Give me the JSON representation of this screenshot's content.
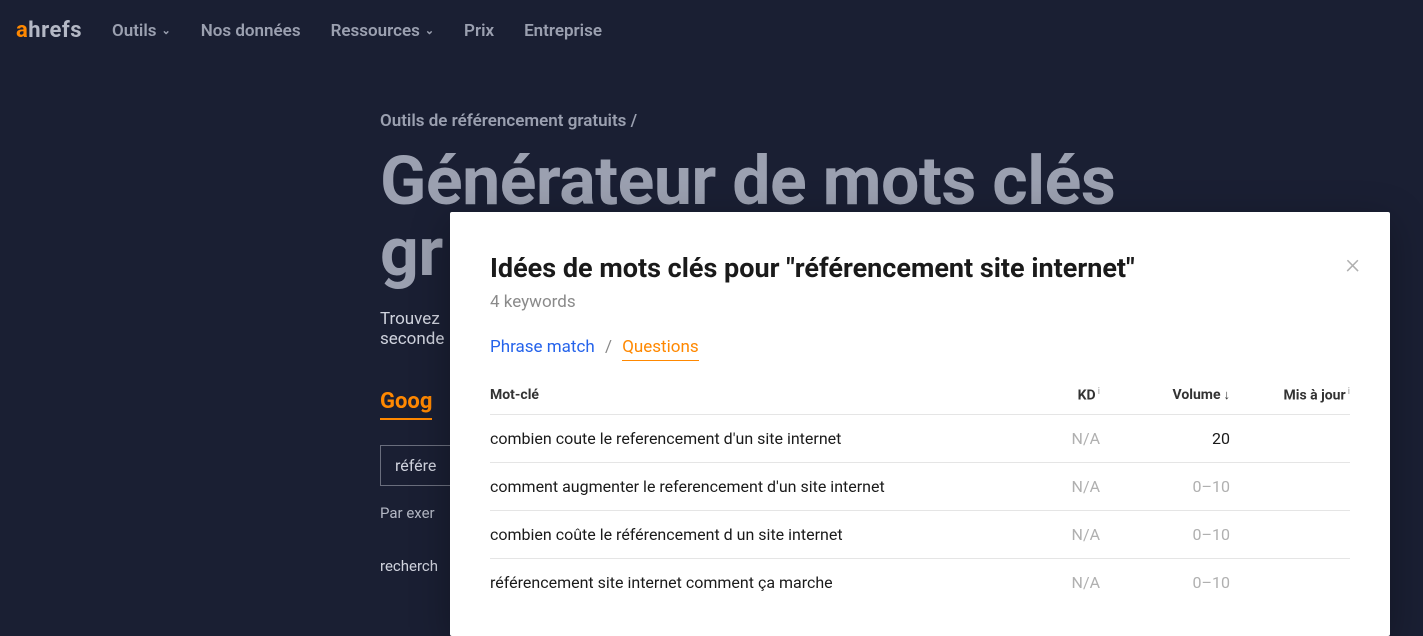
{
  "logo": {
    "first": "a",
    "rest": "hrefs"
  },
  "nav": {
    "tools": "Outils",
    "data": "Nos données",
    "resources": "Ressources",
    "pricing": "Prix",
    "enterprise": "Entreprise"
  },
  "breadcrumb": "Outils de référencement gratuits /",
  "page_title_line1": "Générateur de mots clés",
  "page_title_line2": "gr",
  "subtitle_line1": "Trouvez",
  "subtitle_line2": "seconde",
  "engine_tab": "Goog",
  "search_value": "référe",
  "example_label": "Par exer",
  "recent_label": "recherch",
  "modal": {
    "title": "Idées de mots clés pour \"référencement site internet\"",
    "subtitle": "4 keywords",
    "tab_phrase": "Phrase match",
    "tab_questions": "Questions",
    "columns": {
      "keyword": "Mot-clé",
      "kd": "KD",
      "volume": "Volume",
      "updated": "Mis à jour"
    },
    "rows": [
      {
        "keyword": "combien coute le referencement d'un site internet",
        "kd": "N/A",
        "volume": "20",
        "volume_muted": false
      },
      {
        "keyword": "comment augmenter le referencement d'un site internet",
        "kd": "N/A",
        "volume": "0–10",
        "volume_muted": true
      },
      {
        "keyword": "combien coûte le référencement d un site internet",
        "kd": "N/A",
        "volume": "0–10",
        "volume_muted": true
      },
      {
        "keyword": "référencement site internet comment ça marche",
        "kd": "N/A",
        "volume": "0–10",
        "volume_muted": true
      }
    ]
  }
}
